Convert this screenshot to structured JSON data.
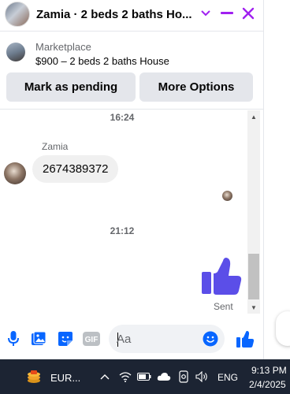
{
  "header": {
    "title": "Zamia · 2 beds 2 baths Ho...",
    "icons": [
      "chevron-down-icon",
      "minimize-icon",
      "close-icon"
    ],
    "accent_color": "#a020f0"
  },
  "listing": {
    "label": "Marketplace",
    "title": "$900 – 2 beds 2 baths House"
  },
  "actions": {
    "pending_label": "Mark as pending",
    "more_label": "More Options"
  },
  "messages": {
    "timestamp_1": "16:24",
    "sender_name": "Zamia",
    "incoming_text": "2674389372",
    "timestamp_2": "21:12",
    "outgoing_sticker": "thumbs-up-icon",
    "status": "Sent"
  },
  "composer": {
    "placeholder": "Aa",
    "icons": [
      "microphone-icon",
      "image-icon",
      "sticker-icon",
      "gif-icon",
      "emoji-icon",
      "thumbs-up-icon"
    ],
    "gif_label": "GIF",
    "brand_color": "#0866ff"
  },
  "taskbar": {
    "app_label": "EUR...",
    "language": "ENG",
    "time": "9:13 PM",
    "date": "2/4/2025",
    "icons": [
      "chevron-up-icon",
      "wifi-icon",
      "battery-icon",
      "cloud-icon",
      "camera-icon",
      "volume-icon"
    ]
  }
}
